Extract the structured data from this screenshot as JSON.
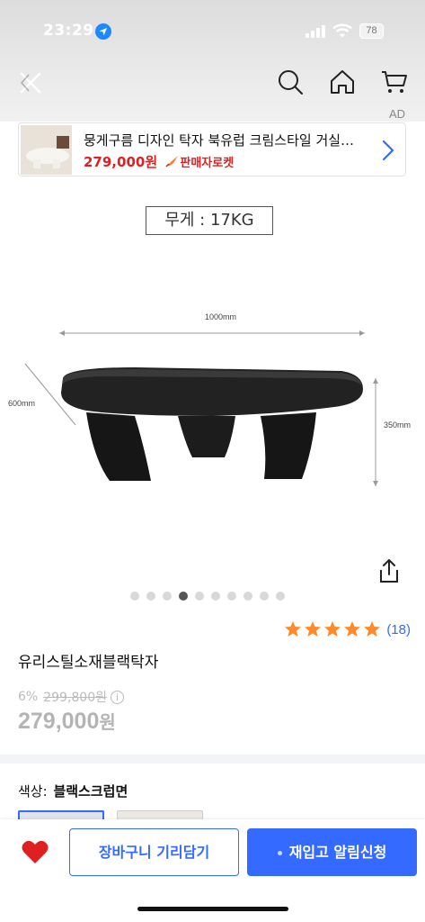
{
  "status_bar": {
    "time": "23:29",
    "battery": "78"
  },
  "nav": {
    "icons": [
      "close-icon",
      "search-icon",
      "home-icon",
      "cart-icon"
    ]
  },
  "ad": {
    "label": "AD",
    "title": "뭉게구름 디자인 탁자 북유럽 크림스타일 거실…",
    "price": "279,000원",
    "badge": "판매자로켓"
  },
  "spec": {
    "weight_label": "무게 :  17KG",
    "width": "1000mm",
    "depth": "600mm",
    "height": "350mm"
  },
  "gallery": {
    "total_images": 10,
    "active_index": 3
  },
  "rating": {
    "stars": 5,
    "review_count": "(18)"
  },
  "product": {
    "name": "유리스틸소재블랙탁자",
    "discount_rate": "6%",
    "original_price": "299,800원",
    "sale_price": "279,000",
    "sale_unit": "원"
  },
  "options": {
    "color_label": "색상:",
    "color_value": "블랙스크럽면"
  },
  "actions": {
    "cart_label": "장바구니 기리담기",
    "notify_label": "재입고 알림신청"
  },
  "colors": {
    "accent": "#346aff",
    "price_red": "#e02020",
    "star": "#ff8a2a"
  }
}
